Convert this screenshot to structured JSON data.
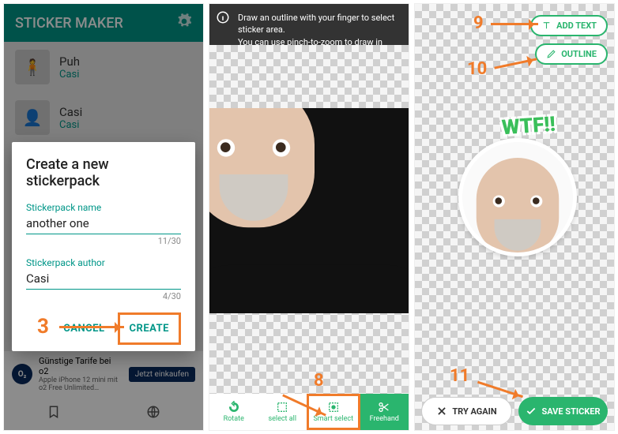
{
  "screen1": {
    "title": "STICKER MAKER",
    "items": [
      {
        "title": "Puh",
        "author": "Casi"
      },
      {
        "title": "Casi",
        "author": "Casi"
      }
    ],
    "dialog": {
      "title": "Create a new stickerpack",
      "name_label": "Stickerpack name",
      "name_value": "another one",
      "name_counter": "11/30",
      "author_label": "Stickerpack author",
      "author_value": "Casi",
      "author_counter": "4/30",
      "cancel": "CANCEL",
      "create": "CREATE"
    },
    "annotation": "3",
    "ad": {
      "headline": "Günstige Tarife bei o2",
      "subline": "Apple iPhone 12 mini mit o2 Free Unlimited…",
      "cta": "Jetzt einkaufen"
    }
  },
  "screen2": {
    "banner_line1": "Draw an outline with your finger to select sticker area.",
    "banner_line2": "You can use pinch-to-zoom to draw in better detail.",
    "tools": {
      "rotate": "Rotate",
      "select_all": "select all",
      "smart_select": "Smart select",
      "freehand": "Freehand"
    },
    "annotation": "8"
  },
  "screen3": {
    "add_text": "ADD TEXT",
    "outline": "OUTLINE",
    "sticker_text": "WTF!!",
    "try_again": "TRY AGAIN",
    "save": "SAVE STICKER",
    "annotations": {
      "a9": "9",
      "a10": "10",
      "a11": "11"
    }
  },
  "colors": {
    "teal": "#009688",
    "green": "#2ab56e",
    "orange": "#f07b2a"
  }
}
